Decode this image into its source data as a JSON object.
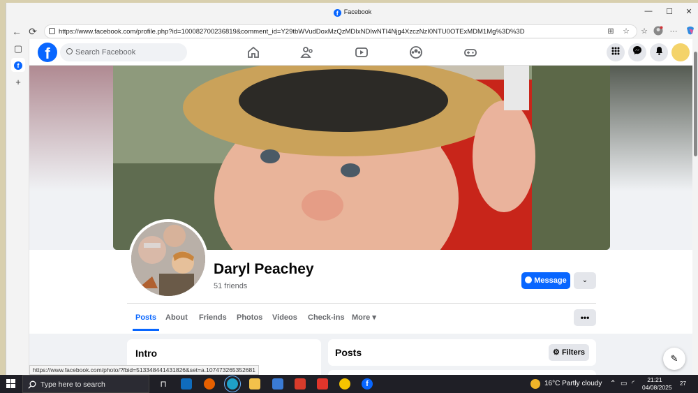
{
  "window": {
    "title": "Facebook",
    "minimize": "—",
    "maximize": "☐",
    "close": "✕"
  },
  "browser": {
    "url": "https://www.facebook.com/profile.php?id=100082700236819&comment_id=Y29tbWVudDoxMzQzMDIxNDIwNTI4Njg4XzczNzI0NTU0OTExMDM1Mg%3D%3D",
    "back": "←",
    "refresh": "⟳",
    "menu": "···"
  },
  "fb": {
    "logo": "f",
    "search_placeholder": "Search Facebook"
  },
  "profile": {
    "name": "Daryl Peachey",
    "friends": "51 friends",
    "message_label": "Message",
    "dropdown": "⌄"
  },
  "tabs": [
    {
      "label": "Posts"
    },
    {
      "label": "About"
    },
    {
      "label": "Friends"
    },
    {
      "label": "Photos"
    },
    {
      "label": "Videos"
    },
    {
      "label": "Check-ins"
    },
    {
      "label": "More ▾"
    }
  ],
  "more_dots": "•••",
  "intro": {
    "title": "Intro"
  },
  "posts": {
    "title": "Posts",
    "filters_label": "Filters"
  },
  "status_url": "https://www.facebook.com/photo/?fbid=513348441431826&set=a.107473265352681",
  "taskbar": {
    "search_placeholder": "Type here to search",
    "weather": "16°C  Partly cloudy",
    "time": "21:21",
    "date": "04/08/2025",
    "notif_count": "27"
  },
  "colors": {
    "accent": "#0866ff"
  },
  "icons": [
    "home-icon",
    "friends-icon",
    "watch-icon",
    "groups-icon",
    "gaming-icon",
    "grid-icon",
    "messenger-icon",
    "bell-icon"
  ]
}
